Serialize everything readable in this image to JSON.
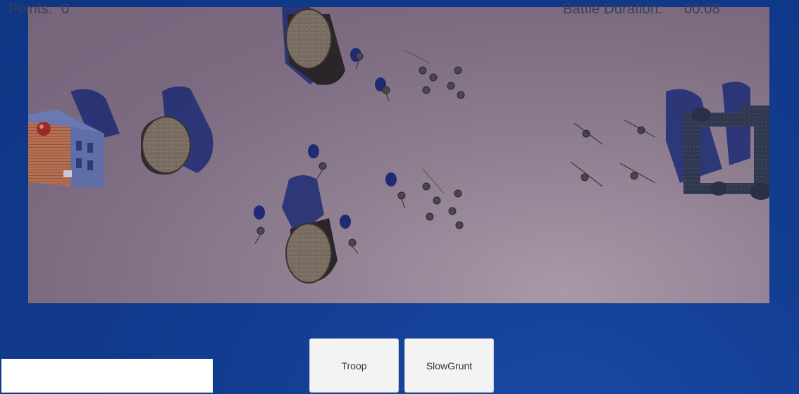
{
  "hud": {
    "points_label": "Points:",
    "points_value": "0",
    "duration_label": "Battle Duration:",
    "duration_value": "00:08"
  },
  "spawn_buttons": {
    "troop_label": "Troop",
    "slowgrunt_label": "SlowGrunt"
  },
  "scene": {
    "field_color": "#8f7f91",
    "border_color": "#113a8c",
    "shadow_color": "#1f2a6e",
    "tower_color": "#6b5e55",
    "castle_color": "#2c3553",
    "house_roof_color": "#b06a4f"
  }
}
